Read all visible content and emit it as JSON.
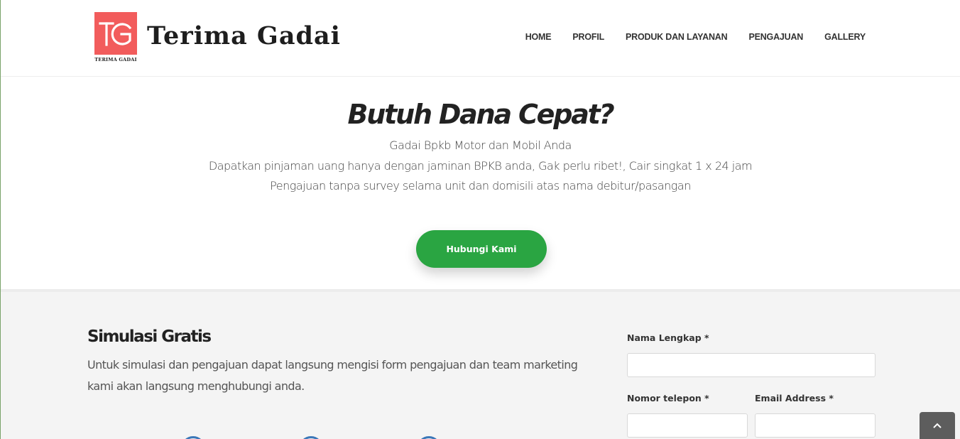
{
  "header": {
    "logo_mark": "TG",
    "logo_caption": "TERIMA GADAI",
    "brand": "Terima Gadai",
    "nav": [
      {
        "label": "HOME"
      },
      {
        "label": "PROFIL"
      },
      {
        "label": "PRODUK DAN LAYANAN"
      },
      {
        "label": "PENGAJUAN"
      },
      {
        "label": "GALLERY"
      }
    ]
  },
  "hero": {
    "title": "Butuh Dana Cepat?",
    "line1": "Gadai Bpkb Motor dan Mobil Anda",
    "line2": "Dapatkan pinjaman uang hanya dengan jaminan BPKB anda, Gak perlu ribet!, Cair singkat 1 x 24 jam",
    "line3": "Pengajuan tanpa survey selama unit dan domisili atas nama debitur/pasangan",
    "cta_label": "Hubungi Kami"
  },
  "simulasi": {
    "title": "Simulasi Gratis",
    "description": "Untuk simulasi dan pengajuan dapat langsung mengisi form pengajuan dan team marketing kami akan langsung menghubungi anda."
  },
  "form": {
    "name_label": "Nama Lengkap *",
    "name_value": "",
    "phone_label": "Nomor telepon *",
    "phone_value": "",
    "email_label": "Email Address *",
    "email_value": ""
  },
  "colors": {
    "logo_bg": "#f25c5c",
    "cta_bg": "#2aa542",
    "section_bg": "#f4f4f4",
    "circle_accent": "#3b77b8",
    "scroll_top_bg": "#5d5d5d"
  },
  "icons": {
    "logo": "tg-logo-icon",
    "scroll_top": "chevron-up-icon"
  }
}
